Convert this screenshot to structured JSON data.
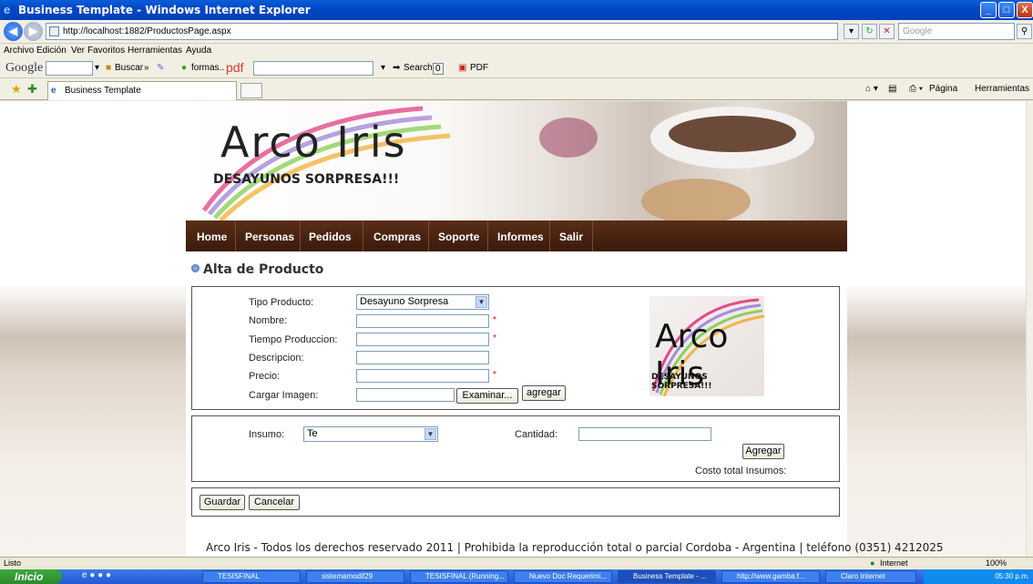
{
  "window": {
    "title": "Business Template - Windows Internet Explorer",
    "controls": {
      "minimize": "_",
      "maximize": "□",
      "close": "X"
    }
  },
  "addressbar": {
    "url": "http://localhost:1882/ProductosPage.aspx",
    "search_placeholder": "Google"
  },
  "menu": [
    "Archivo",
    "Edición",
    "Ver",
    "Favoritos",
    "Herramientas",
    "Ayuda"
  ],
  "google_toolbar": {
    "logo": "Google",
    "buscar": "Buscar",
    "formas": "formas..",
    "pdf_logo": "pdf",
    "search": "Search",
    "count": "0",
    "pdf": "PDF"
  },
  "tabs": {
    "active": "Business Template",
    "right_commands": {
      "pagina": "Página",
      "herramientas": "Herramientas"
    }
  },
  "site": {
    "brand": "Arco Iris",
    "tagline": "DESAYUNOS SORPRESA!!!",
    "nav": [
      "Home",
      "Personas",
      "Pedidos",
      "Compras",
      "Soporte",
      "Informes",
      "Salir"
    ],
    "page_title": "Alta de Producto",
    "form": {
      "tipo_producto_label": "Tipo Producto:",
      "tipo_producto_value": "Desayuno Sorpresa",
      "nombre_label": "Nombre:",
      "tiempo_label": "Tiempo Produccion:",
      "descripcion_label": "Descripcion:",
      "precio_label": "Precio:",
      "imagen_label": "Cargar Imagen:",
      "required_mark": "*",
      "examinar": "Examinar...",
      "agregar": "agregar"
    },
    "insumos": {
      "insumo_label": "Insumo:",
      "insumo_value": "Te",
      "cantidad_label": "Cantidad:",
      "agregar": "Agregar",
      "costo_label": "Costo total Insumos:"
    },
    "actions": {
      "guardar": "Guardar",
      "cancelar": "Cancelar"
    },
    "footer": "Arco Iris - Todos los derechos reservado 2011 | Prohibida la reproducción total o parcial Cordoba - Argentina | teléfono (0351) 4212025"
  },
  "status": {
    "left": "Listo",
    "zone": "Internet",
    "zoom": "100%"
  },
  "taskbar": {
    "start": "Inicio",
    "tasks": [
      "TESISFINAL",
      "sistemamodif29",
      "TESISFINAL (Running...",
      "Nuevo Doc Requerimi...",
      "Business Template - ...",
      "http://www.gamba.f...",
      "Claro Internet"
    ],
    "clock": "05:30 p.m."
  }
}
